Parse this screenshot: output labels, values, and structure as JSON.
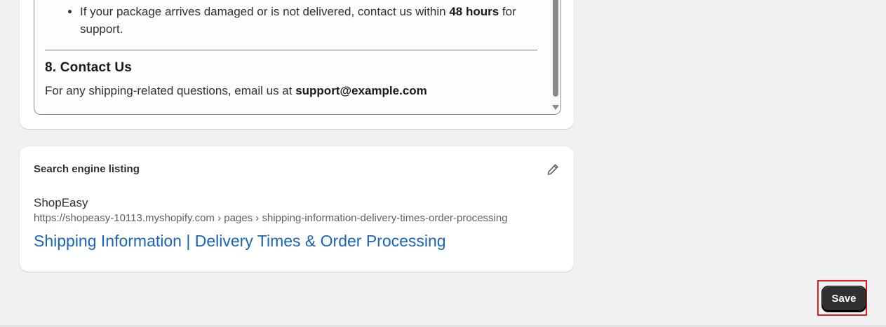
{
  "content": {
    "bullet": {
      "text_before": "If your package arrives damaged or is not delivered, contact us within ",
      "bold": "48 hours",
      "text_after": " for support."
    },
    "contact_heading": "8. Contact Us",
    "contact_text": "For any shipping-related questions, email us at ",
    "contact_email": "support@example.com"
  },
  "seo": {
    "title": "Search engine listing",
    "edit_icon": "pencil-icon",
    "store_name": "ShopEasy",
    "url": "https://shopeasy-10113.myshopify.com › pages › shipping-information-delivery-times-order-processing",
    "page_title": "Shipping Information | Delivery Times & Order Processing"
  },
  "footer": {
    "save_label": "Save"
  },
  "colors": {
    "link_blue": "#1a66b5",
    "save_bg": "#303030",
    "highlight": "#e01e1e",
    "background": "#f1f1f1"
  }
}
